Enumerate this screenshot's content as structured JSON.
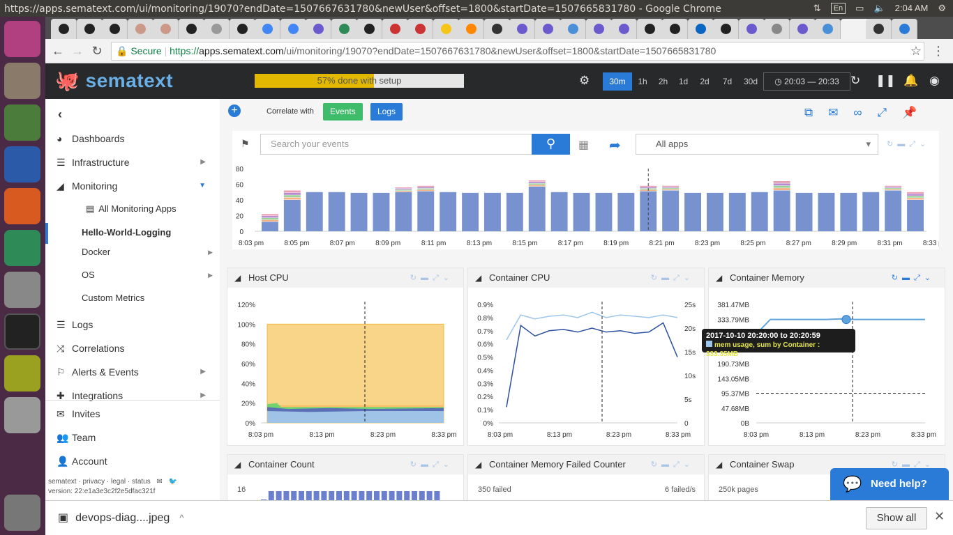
{
  "window": {
    "title": "https://apps.sematext.com/ui/monitoring/19070?endDate=1507667631780&newUser&offset=1800&startDate=1507665831780 - Google Chrome",
    "keyboard": "En",
    "clock": "2:04 AM"
  },
  "browser": {
    "secure_label": "Secure",
    "url_scheme": "https://",
    "url_host": "apps.sematext.com",
    "url_path": "/ui/monitoring/19070?endDate=1507667631780&newUser&offset=1800&startDate=1507665831780"
  },
  "header": {
    "logo": "sematext",
    "setup_progress_text": "57% done with setup",
    "setup_progress": 0.57,
    "time_buttons": [
      "30m",
      "1h",
      "2h",
      "1d",
      "2d",
      "7d",
      "30d"
    ],
    "active_time": "30m",
    "range": "20:03 — 20:33"
  },
  "sidebar": {
    "items": [
      {
        "label": "Dashboards",
        "icon": "dashboard-icon"
      },
      {
        "label": "Infrastructure",
        "icon": "server-icon"
      },
      {
        "label": "Monitoring",
        "icon": "area-chart-icon"
      }
    ],
    "sub_all_apps": "All Monitoring Apps",
    "active_app": "Hello-World-Logging",
    "sub_items": [
      "Docker",
      "OS",
      "Custom Metrics"
    ],
    "items2": [
      {
        "label": "Logs",
        "icon": "list-icon"
      },
      {
        "label": "Correlations",
        "icon": "shuffle-icon"
      },
      {
        "label": "Alerts & Events",
        "icon": "flag-icon"
      },
      {
        "label": "Integrations",
        "icon": "puzzle-icon"
      }
    ],
    "items3": [
      {
        "label": "Invites",
        "icon": "envelope-icon"
      },
      {
        "label": "Team",
        "icon": "team-icon"
      },
      {
        "label": "Account",
        "icon": "user-icon"
      }
    ],
    "footer_links": "sematext · privacy · legal · status",
    "version": "version: 22:e1a3e3c2f2e5dfac321f"
  },
  "main": {
    "correlate_label": "Correlate with",
    "events_button": "Events",
    "logs_button": "Logs",
    "search_placeholder": "Search your events",
    "app_select": "All apps"
  },
  "events_chart": {
    "y_ticks": [
      "80",
      "60",
      "40",
      "20",
      "0"
    ],
    "x_ticks": [
      "8:03 pm",
      "8:05 pm",
      "8:07 pm",
      "8:09 pm",
      "8:11 pm",
      "8:13 pm",
      "8:15 pm",
      "8:17 pm",
      "8:19 pm",
      "8:21 pm",
      "8:23 pm",
      "8:25 pm",
      "8:27 pm",
      "8:29 pm",
      "8:31 pm",
      "8:33 pm"
    ]
  },
  "panels": {
    "host_cpu": {
      "title": "Host CPU",
      "y_ticks": [
        "120%",
        "100%",
        "80%",
        "60%",
        "40%",
        "20%",
        "0%"
      ],
      "x_ticks": [
        "8:03 pm",
        "8:13 pm",
        "8:23 pm",
        "8:33 pm"
      ]
    },
    "container_cpu": {
      "title": "Container CPU",
      "y_ticks": [
        "0.9%",
        "0.8%",
        "0.7%",
        "0.6%",
        "0.5%",
        "0.4%",
        "0.3%",
        "0.2%",
        "0.1%",
        "0%"
      ],
      "y2_ticks": [
        "25s",
        "20s",
        "15s",
        "10s",
        "5s",
        "0"
      ],
      "x_ticks": [
        "8:03 pm",
        "8:13 pm",
        "8:23 pm",
        "8:33 pm"
      ]
    },
    "container_memory": {
      "title": "Container Memory",
      "y_ticks": [
        "381.47MB",
        "333.79MB",
        "286.1MB",
        "238.42MB",
        "190.73MB",
        "143.05MB",
        "95.37MB",
        "47.68MB",
        "0B"
      ],
      "x_ticks": [
        "8:03 pm",
        "8:13 pm",
        "8:23 pm",
        "8:33 pm"
      ]
    },
    "container_count": {
      "title": "Container Count",
      "y_top": "16"
    },
    "container_memory_failed": {
      "title": "Container Memory Failed Counter",
      "y_left": "350 failed",
      "y_right": "6 failed/s"
    },
    "container_swap": {
      "title": "Container Swap",
      "y_top": "250k pages"
    }
  },
  "tooltip": {
    "line1": "2017-10-10 20:20:00 to 20:20:59",
    "line2": "mem usage, sum by Container : 333.35MB"
  },
  "help_widget": "Need help?",
  "downloads": {
    "file": "devops-diag....jpeg",
    "show_all": "Show all"
  },
  "chart_data": [
    {
      "type": "bar",
      "title": "",
      "categories": [
        "8:03",
        "8:04",
        "8:05",
        "8:06",
        "8:07",
        "8:08",
        "8:09",
        "8:10",
        "8:11",
        "8:12",
        "8:13",
        "8:14",
        "8:15",
        "8:16",
        "8:17",
        "8:18",
        "8:19",
        "8:20",
        "8:21",
        "8:22",
        "8:23",
        "8:24",
        "8:25",
        "8:26",
        "8:27",
        "8:28",
        "8:29",
        "8:30",
        "8:31",
        "8:32",
        "8:33"
      ],
      "series": [
        {
          "values": [
            12,
            40,
            50,
            50,
            49,
            49,
            50,
            51,
            50,
            49,
            49,
            49,
            57,
            50,
            49,
            49,
            49,
            51,
            52,
            49,
            49,
            49,
            50,
            52,
            49,
            49,
            49,
            50,
            52,
            40
          ]
        },
        {
          "values": [
            10,
            12,
            0,
            0,
            0,
            0,
            6,
            7,
            0,
            0,
            0,
            0,
            8,
            0,
            0,
            0,
            0,
            7,
            6,
            0,
            0,
            0,
            0,
            12,
            0,
            0,
            0,
            0,
            6,
            10
          ]
        }
      ],
      "ylim": [
        0,
        80
      ]
    },
    {
      "type": "area",
      "title": "Host CPU",
      "x": [
        "8:03 pm",
        "8:13 pm",
        "8:23 pm",
        "8:33 pm"
      ],
      "series": [
        {
          "values": [
            100,
            100,
            100,
            100
          ]
        },
        {
          "values": [
            17,
            15,
            16,
            16
          ]
        },
        {
          "values": [
            12,
            11,
            12,
            12
          ]
        }
      ],
      "ylim": [
        0,
        120
      ]
    },
    {
      "type": "line",
      "title": "Container CPU",
      "series": [
        {
          "values": [
            0.63,
            0.82,
            0.79,
            0.81,
            0.82,
            0.8,
            0.84,
            0.8,
            0.82,
            0.81,
            0.8,
            0.82,
            0.8
          ]
        },
        {
          "values": [
            0.12,
            0.74,
            0.66,
            0.7,
            0.71,
            0.69,
            0.72,
            0.69,
            0.7,
            0.68,
            0.69,
            0.76,
            0.5
          ]
        }
      ],
      "ylim": [
        0,
        0.9
      ]
    },
    {
      "type": "line",
      "title": "Container Memory",
      "series": [
        {
          "values": [
            286,
            333,
            333,
            333,
            333,
            333,
            335,
            333,
            333,
            333,
            333,
            333,
            333
          ]
        },
        {
          "values": [
            95.37,
            95.37,
            95.37,
            95.37,
            95.37,
            95.37,
            95.37,
            95.37,
            95.37,
            95.37,
            95.37,
            95.37,
            95.37
          ]
        }
      ],
      "ylim": [
        0,
        381.47
      ]
    }
  ]
}
